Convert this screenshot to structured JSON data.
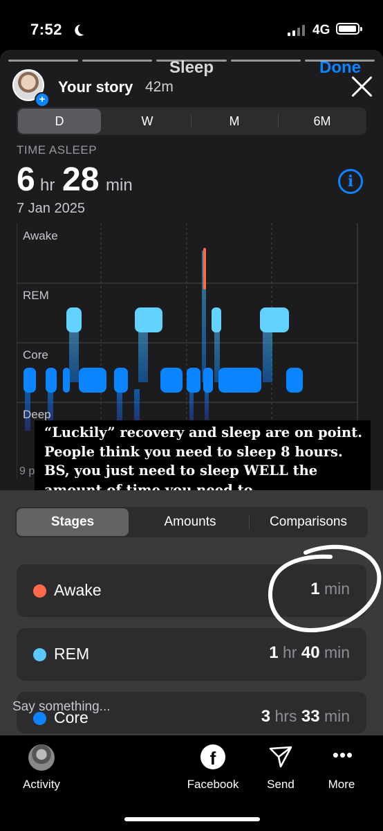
{
  "status": {
    "time": "7:52",
    "network": "4G"
  },
  "sheet": {
    "title": "Sleep",
    "done_label": "Done"
  },
  "story": {
    "name": "Your story",
    "age": "42m"
  },
  "periods": [
    "D",
    "W",
    "M",
    "6M"
  ],
  "selected_period": "D",
  "summary": {
    "label": "TIME ASLEEP",
    "hours": "6",
    "hours_unit": "hr",
    "minutes": "28",
    "minutes_unit": "min",
    "date": "7 Jan 2025"
  },
  "chart_data": {
    "type": "timeline",
    "stages": [
      "Awake",
      "REM",
      "Core",
      "Deep"
    ],
    "start_tick_partial": "9 p",
    "colors": {
      "Awake": "#ff6b4a",
      "REM": "#5ac8fa",
      "Core": "#0a84ff",
      "Deep": "#2c3ea8"
    }
  },
  "caption": "“Luckily” recovery and sleep are on point. People think you need to sleep 8 hours. BS, you just need to sleep WELL the amount of time you need to.",
  "tabs": [
    "Stages",
    "Amounts",
    "Comparisons"
  ],
  "selected_tab": "Stages",
  "stages": [
    {
      "name": "Awake",
      "color": "#ff6b4a",
      "parts": [
        {
          "num": "1",
          "unit": "min"
        }
      ]
    },
    {
      "name": "REM",
      "color": "#5ac8fa",
      "parts": [
        {
          "num": "1",
          "unit": "hr"
        },
        {
          "num": "40",
          "unit": "min"
        }
      ]
    },
    {
      "name": "Core",
      "color": "#0a84ff",
      "parts": [
        {
          "num": "3",
          "unit": "hrs"
        },
        {
          "num": "33",
          "unit": "min"
        }
      ]
    }
  ],
  "reply_placeholder": "Say something...",
  "bottom_bar": {
    "activity": "Activity",
    "facebook": "Facebook",
    "send": "Send",
    "more": "More"
  }
}
